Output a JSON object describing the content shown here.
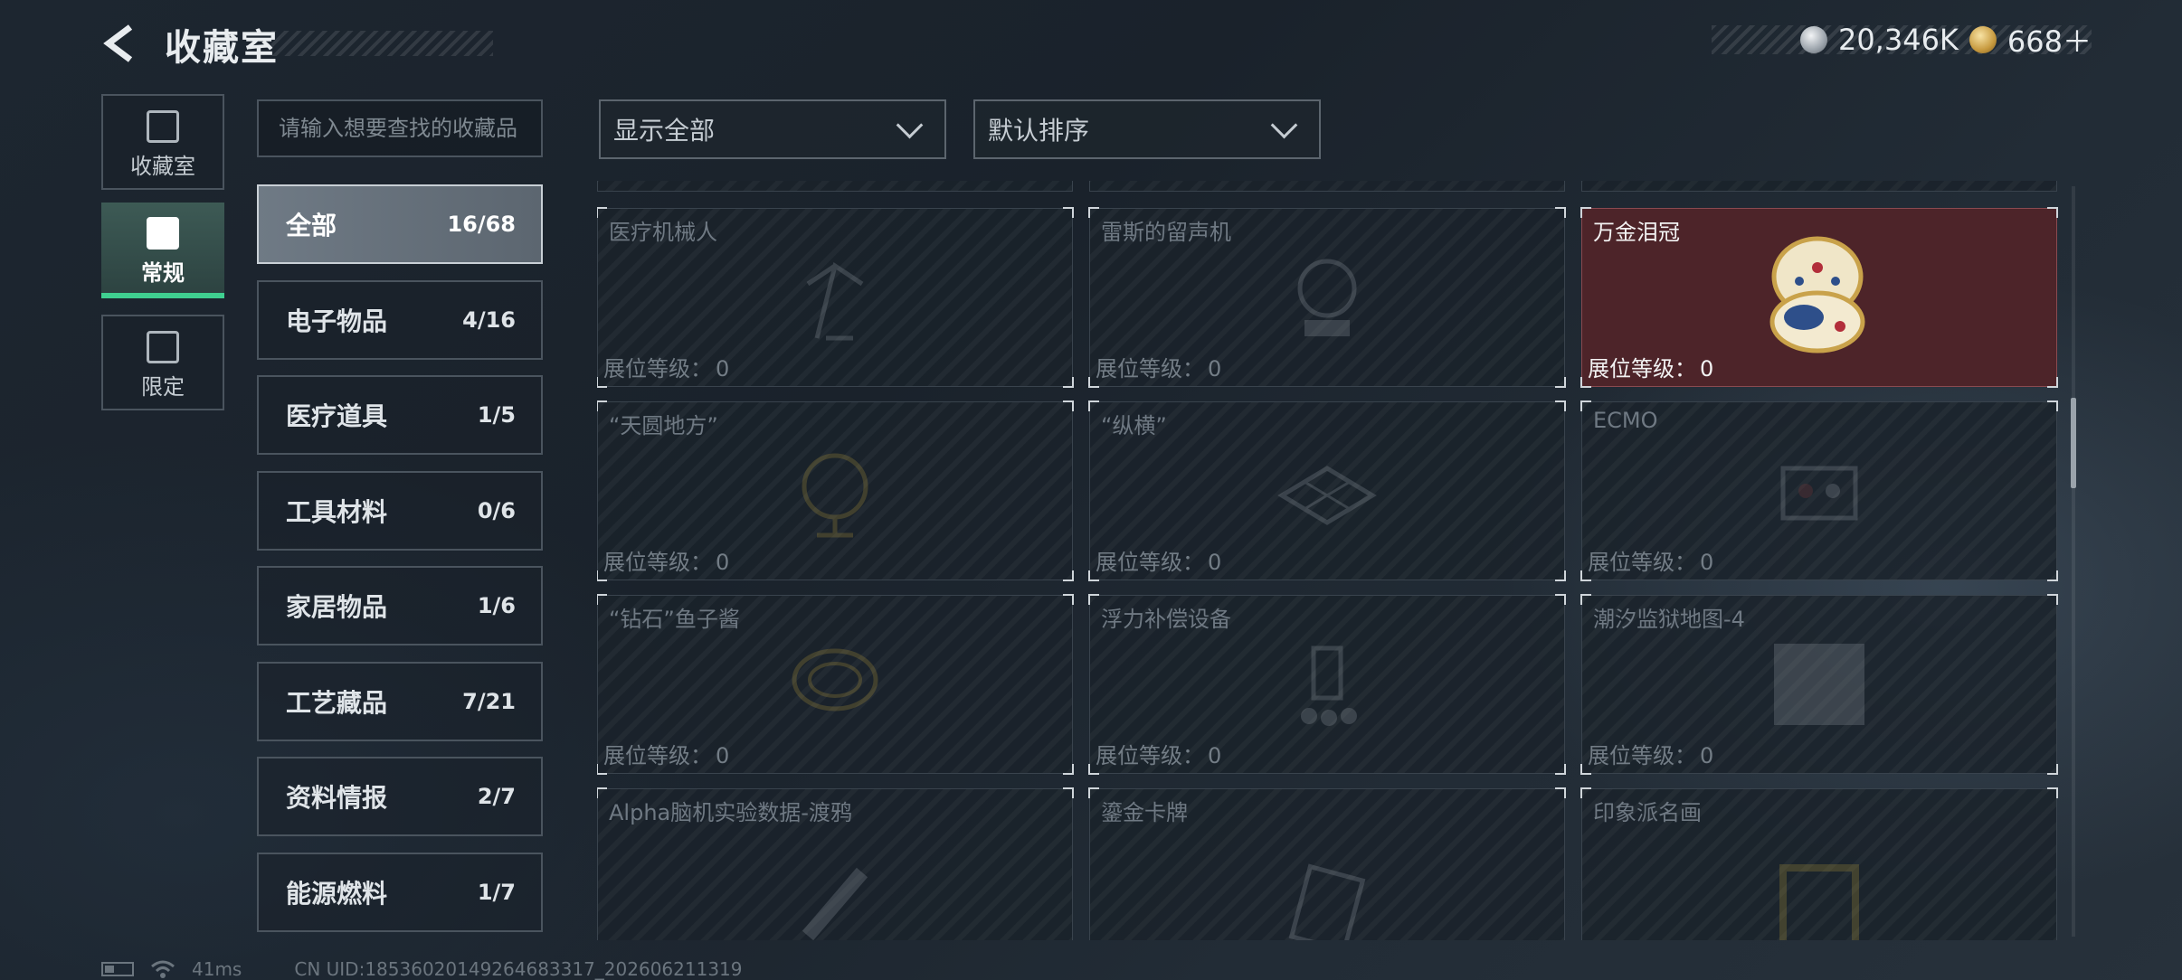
{
  "header": {
    "title": "收藏室",
    "currencies": [
      {
        "icon": "silver-coin-icon",
        "value": "20,346K"
      },
      {
        "icon": "gold-coin-icon",
        "value": "668＋"
      }
    ]
  },
  "left_nav": [
    {
      "label": "收藏室",
      "icon": "collection-room-icon",
      "active": false
    },
    {
      "label": "常规",
      "icon": "regular-icon",
      "active": true
    },
    {
      "label": "限定",
      "icon": "limited-icon",
      "active": false
    }
  ],
  "search": {
    "placeholder": "请输入想要查找的收藏品",
    "value": ""
  },
  "filter_dropdown": {
    "value": "显示全部"
  },
  "sort_dropdown": {
    "value": "默认排序"
  },
  "categories": [
    {
      "name": "全部",
      "count": "16/68",
      "active": true
    },
    {
      "name": "电子物品",
      "count": "4/16"
    },
    {
      "name": "医疗道具",
      "count": "1/5"
    },
    {
      "name": "工具材料",
      "count": "0/6"
    },
    {
      "name": "家居物品",
      "count": "1/6"
    },
    {
      "name": "工艺藏品",
      "count": "7/21"
    },
    {
      "name": "资料情报",
      "count": "2/7"
    },
    {
      "name": "能源燃料",
      "count": "1/7"
    }
  ],
  "level_label": "展位等级：",
  "items": [
    {
      "name": "医疗机械人",
      "level": "0",
      "unlocked": false
    },
    {
      "name": "雷斯的留声机",
      "level": "0",
      "unlocked": false
    },
    {
      "name": "万金泪冠",
      "level": "0",
      "unlocked": true
    },
    {
      "name": "“天圆地方”",
      "level": "0",
      "unlocked": false
    },
    {
      "name": "“纵横”",
      "level": "0",
      "unlocked": false
    },
    {
      "name": "ECMO",
      "level": "0",
      "unlocked": false
    },
    {
      "name": "“钻石”鱼子酱",
      "level": "0",
      "unlocked": false
    },
    {
      "name": "浮力补偿设备",
      "level": "0",
      "unlocked": false
    },
    {
      "name": "潮汐监狱地图-4",
      "level": "0",
      "unlocked": false
    },
    {
      "name": "Alpha脑机实验数据-渡鸦",
      "level": "",
      "unlocked": false
    },
    {
      "name": "鎏金卡牌",
      "level": "",
      "unlocked": false
    },
    {
      "name": "印象派名画",
      "level": "",
      "unlocked": false
    }
  ],
  "footer": {
    "ping": "41ms",
    "uid": "CN UID:18536020149264683317_202606211319"
  }
}
